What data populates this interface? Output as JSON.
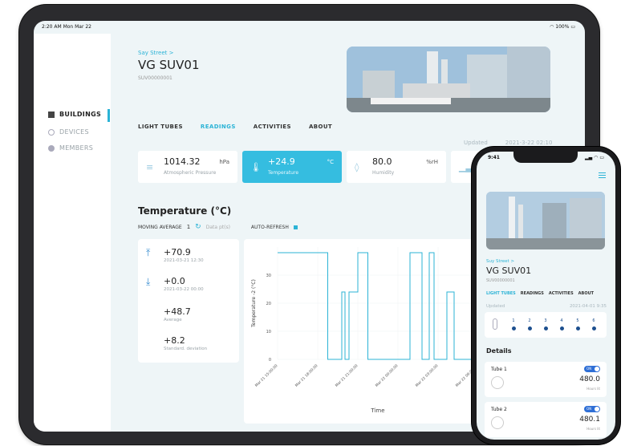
{
  "ipad": {
    "status": {
      "time": "2:20 AM  Mon Mar 22",
      "battery": "100%"
    },
    "sidebar": {
      "items": [
        {
          "label": "BUILDINGS",
          "active": true,
          "icon": "building-icon"
        },
        {
          "label": "DEVICES",
          "active": false,
          "icon": "device-icon"
        },
        {
          "label": "MEMBERS",
          "active": false,
          "icon": "members-icon"
        }
      ]
    },
    "header": {
      "breadcrumb": "Say Street >",
      "title": "VG SUV01",
      "serial": "SUV00000001"
    },
    "tabs": [
      "LIGHT TUBES",
      "READINGS",
      "ACTIVITIES",
      "ABOUT"
    ],
    "active_tab": "READINGS",
    "updated": {
      "label": "Updated",
      "value": "2021-3-22 02:10"
    },
    "stats": [
      {
        "value": "1014.32",
        "unit": "hPa",
        "label": "Atmospheric Pressure",
        "icon": "wind-icon",
        "highlight": false
      },
      {
        "value": "+24.9",
        "unit": "°C",
        "label": "Temperature",
        "icon": "thermometer-icon",
        "highlight": true
      },
      {
        "value": "80.0",
        "unit": "%rH",
        "label": "Humidity",
        "icon": "drop-icon",
        "highlight": false
      },
      {
        "value": "",
        "unit": "",
        "label": "",
        "icon": "signal-icon",
        "highlight": false
      }
    ],
    "section": {
      "title": "Temperature (°C)",
      "moving_average_label": "MOVING AVERAGE",
      "moving_average_value": "1",
      "data_points_label": "Data pt(s)",
      "auto_refresh_label": "AUTO-REFRESH"
    },
    "summary": [
      {
        "value": "+70.9",
        "sub": "2021-03-21 12:30",
        "icon": "arrow-up-icon"
      },
      {
        "value": "+0.0",
        "sub": "2021-03-22 00:00",
        "icon": "arrow-down-icon"
      },
      {
        "value": "+48.7",
        "sub": "Average",
        "icon": ""
      },
      {
        "value": "+8.2",
        "sub": "Standard. deviation",
        "icon": ""
      }
    ],
    "colors": {
      "accent": "#2bb3d6",
      "line": "#2bb3d6"
    }
  },
  "chart_data": {
    "type": "line",
    "xlabel": "Time",
    "ylabel": "Temperature -2 (°C)",
    "ylim": [
      0,
      40
    ],
    "yticks": [
      0,
      10,
      20,
      30
    ],
    "x_ticks": [
      "Mar 21 15:00:00",
      "Mar 21 18:00:00",
      "Mar 21 21:00:00",
      "Mar 22 00:00:00",
      "Mar 22 03:00:00",
      "Mar 22 06:00:00"
    ],
    "grid": true,
    "series": [
      {
        "x": [
          0,
          1.25,
          1.25,
          1.6,
          1.6,
          1.68,
          1.68,
          1.78,
          1.78,
          2.0,
          2.0,
          2.25,
          2.25,
          3.3,
          3.3,
          3.6,
          3.6,
          3.78,
          3.78,
          3.9,
          3.9,
          4.22,
          4.22,
          4.4,
          4.4,
          5.0
        ],
        "y": [
          38,
          38,
          0,
          0,
          24,
          24,
          0,
          0,
          24,
          24,
          38,
          38,
          0,
          0,
          38,
          38,
          0,
          0,
          38,
          38,
          0,
          0,
          24,
          24,
          0,
          0
        ]
      }
    ]
  },
  "iphone": {
    "status": {
      "time": "9:41"
    },
    "breadcrumb": "Suy Street >",
    "title": "VG SUV01",
    "serial": "SUV00000001",
    "tabs": [
      "LIGHT TUBES",
      "READINGS",
      "ACTIVITIES",
      "ABOUT"
    ],
    "active_tab": "LIGHT TUBES",
    "updated": {
      "label": "Updated",
      "value": "2021-04-01 9:35"
    },
    "tube_numbers": [
      "1",
      "2",
      "3",
      "4",
      "5",
      "6"
    ],
    "details_title": "Details",
    "tubes": [
      {
        "name": "Tube 1",
        "toggle": "ON",
        "hours": "480.0",
        "hours_label": "Hours lit"
      },
      {
        "name": "Tube 2",
        "toggle": "ON",
        "hours": "480.1",
        "hours_label": "Hours lit"
      }
    ]
  }
}
